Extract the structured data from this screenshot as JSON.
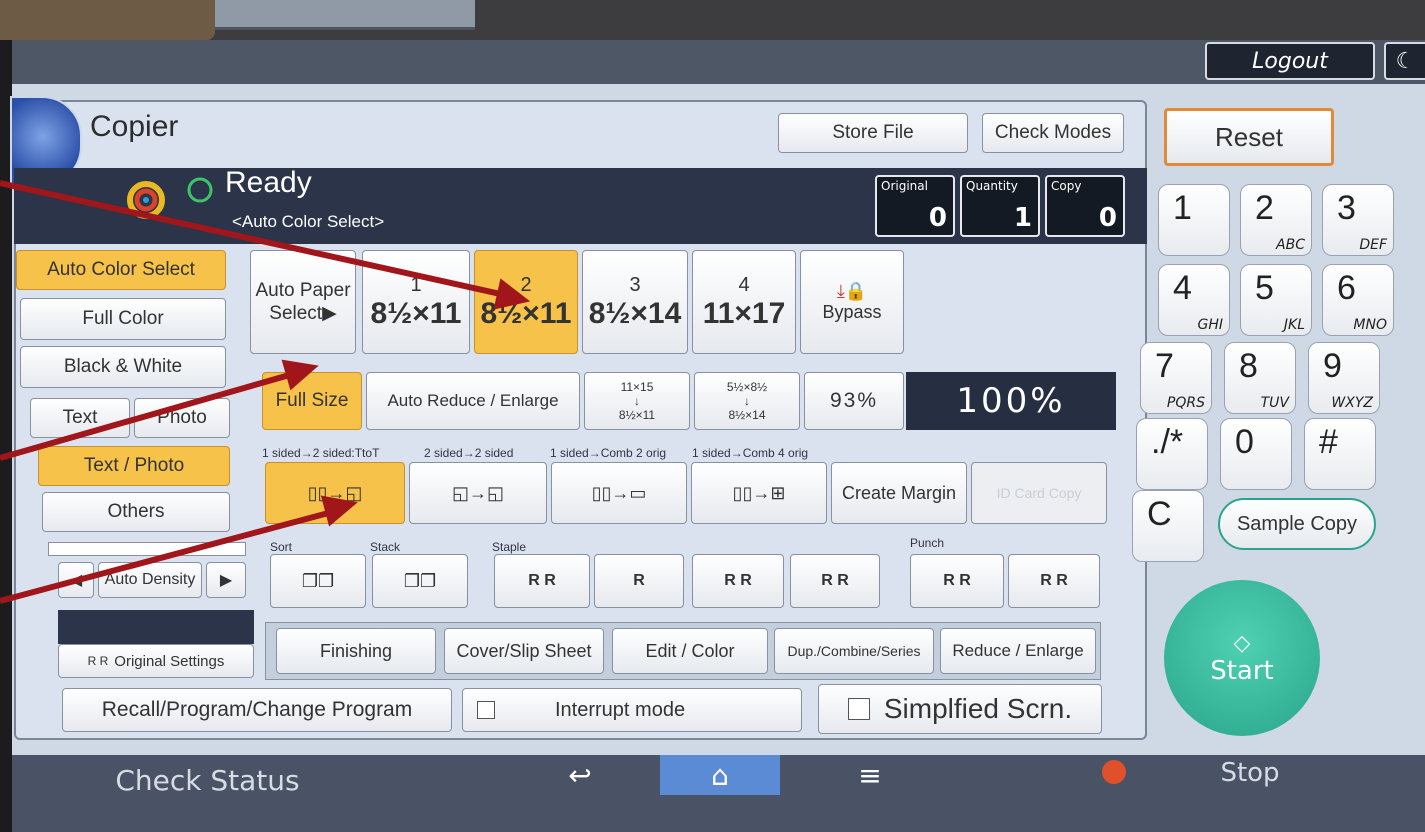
{
  "header": {
    "logout_label": "Logout",
    "moon_glyph": "☾"
  },
  "app": {
    "title": "Copier",
    "store_file": "Store File",
    "check_modes": "Check Modes"
  },
  "status": {
    "ready": "Ready",
    "color_mode": "<Auto Color Select>",
    "counters": [
      {
        "label": "Original",
        "value": "0"
      },
      {
        "label": "Quantity",
        "value": "1"
      },
      {
        "label": "Copy",
        "value": "0"
      }
    ]
  },
  "color_modes": [
    "Auto Color Select",
    "Full Color",
    "Black & White"
  ],
  "original_type": {
    "text": "Text",
    "photo": "Photo",
    "text_photo": "Text / Photo",
    "others": "Others"
  },
  "density": {
    "label": "Auto Density"
  },
  "original_settings": "Original Settings",
  "paper": {
    "auto_paper": "Auto Paper Select▶",
    "trays": [
      {
        "num": "1",
        "size": "8½×11"
      },
      {
        "num": "2",
        "size": "8½×11"
      },
      {
        "num": "3",
        "size": "8½×14"
      },
      {
        "num": "4",
        "size": "11×17"
      }
    ],
    "bypass": "Bypass"
  },
  "reduce": {
    "full_size": "Full Size",
    "auto_reduce": "Auto Reduce / Enlarge",
    "r1_top": "11×15",
    "r1_bot": "8½×11",
    "r2_top": "5½×8½",
    "r2_bot": "8½×14",
    "percent": "93%",
    "current": "100%"
  },
  "duplex": {
    "labels": [
      "1 sided→2 sided:TtoT",
      "2 sided→2 sided",
      "1 sided→Comb 2 orig",
      "1 sided→Comb 4 orig"
    ],
    "create_margin": "Create Margin",
    "id_card": "ID Card Copy"
  },
  "finishing_labels": {
    "sort": "Sort",
    "stack": "Stack",
    "staple": "Staple",
    "punch": "Punch"
  },
  "tabs": [
    "Finishing",
    "Cover/Slip Sheet",
    "Edit / Color",
    "Dup./Combine/Series",
    "Reduce / Enlarge"
  ],
  "bottom_actions": {
    "recall": "Recall/Program/Change Program",
    "interrupt": "Interrupt mode",
    "simplified": "Simplfied Scrn."
  },
  "right": {
    "reset": "Reset",
    "sample_copy": "Sample Copy",
    "start": "Start",
    "stop": "Stop"
  },
  "keypad": [
    {
      "d": "1",
      "l": ""
    },
    {
      "d": "2",
      "l": "ABC"
    },
    {
      "d": "3",
      "l": "DEF"
    },
    {
      "d": "4",
      "l": "GHI"
    },
    {
      "d": "5",
      "l": "JKL"
    },
    {
      "d": "6",
      "l": "MNO"
    },
    {
      "d": "7",
      "l": "PQRS"
    },
    {
      "d": "8",
      "l": "TUV"
    },
    {
      "d": "9",
      "l": "WXYZ"
    },
    {
      "d": "./*",
      "l": ""
    },
    {
      "d": "0",
      "l": ""
    },
    {
      "d": "#",
      "l": ""
    },
    {
      "d": "C",
      "l": ""
    }
  ],
  "bottom": {
    "check_status": "Check Status"
  },
  "colors": {
    "selected": "#f6c24a",
    "start": "#2aa58a",
    "annotation_arrow": "#a0161a"
  }
}
